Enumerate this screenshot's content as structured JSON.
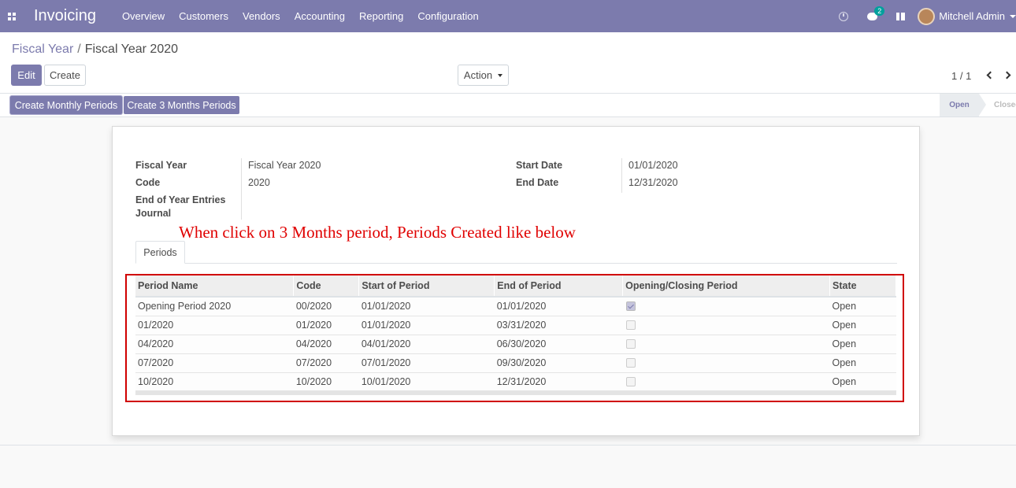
{
  "navbar": {
    "app_name": "Invoicing",
    "menu": [
      "Overview",
      "Customers",
      "Vendors",
      "Accounting",
      "Reporting",
      "Configuration"
    ],
    "messages_badge": "2",
    "user_name": "Mitchell Admin"
  },
  "breadcrumb": {
    "parent": "Fiscal Year",
    "separator": "/",
    "current": "Fiscal Year 2020"
  },
  "buttons": {
    "edit": "Edit",
    "create": "Create",
    "action": "Action"
  },
  "pager": {
    "text": "1 / 1"
  },
  "statusbar": {
    "create_monthly": "Create Monthly Periods",
    "create_3months": "Create 3 Months Periods",
    "stages": [
      "Open",
      "Closed"
    ]
  },
  "form": {
    "fiscal_year_label": "Fiscal Year",
    "fiscal_year_value": "Fiscal Year 2020",
    "code_label": "Code",
    "code_value": "2020",
    "journal_label": "End of Year Entries Journal",
    "journal_value": "",
    "start_date_label": "Start Date",
    "start_date_value": "01/01/2020",
    "end_date_label": "End Date",
    "end_date_value": "12/31/2020"
  },
  "annotation": "When click on 3 Months period, Periods Created like below",
  "tabs": [
    "Periods"
  ],
  "periods_table": {
    "columns": [
      "Period Name",
      "Code",
      "Start of Period",
      "End of Period",
      "Opening/Closing Period",
      "State"
    ],
    "rows": [
      {
        "name": "Opening Period 2020",
        "code": "00/2020",
        "start": "01/01/2020",
        "end": "01/01/2020",
        "opening": true,
        "state": "Open"
      },
      {
        "name": "01/2020",
        "code": "01/2020",
        "start": "01/01/2020",
        "end": "03/31/2020",
        "opening": false,
        "state": "Open"
      },
      {
        "name": "04/2020",
        "code": "04/2020",
        "start": "04/01/2020",
        "end": "06/30/2020",
        "opening": false,
        "state": "Open"
      },
      {
        "name": "07/2020",
        "code": "07/2020",
        "start": "07/01/2020",
        "end": "09/30/2020",
        "opening": false,
        "state": "Open"
      },
      {
        "name": "10/2020",
        "code": "10/2020",
        "start": "10/01/2020",
        "end": "12/31/2020",
        "opening": false,
        "state": "Open"
      }
    ]
  },
  "colors": {
    "brand": "#7c7bad",
    "annotation": "#e00000",
    "badge": "#00a09d"
  }
}
